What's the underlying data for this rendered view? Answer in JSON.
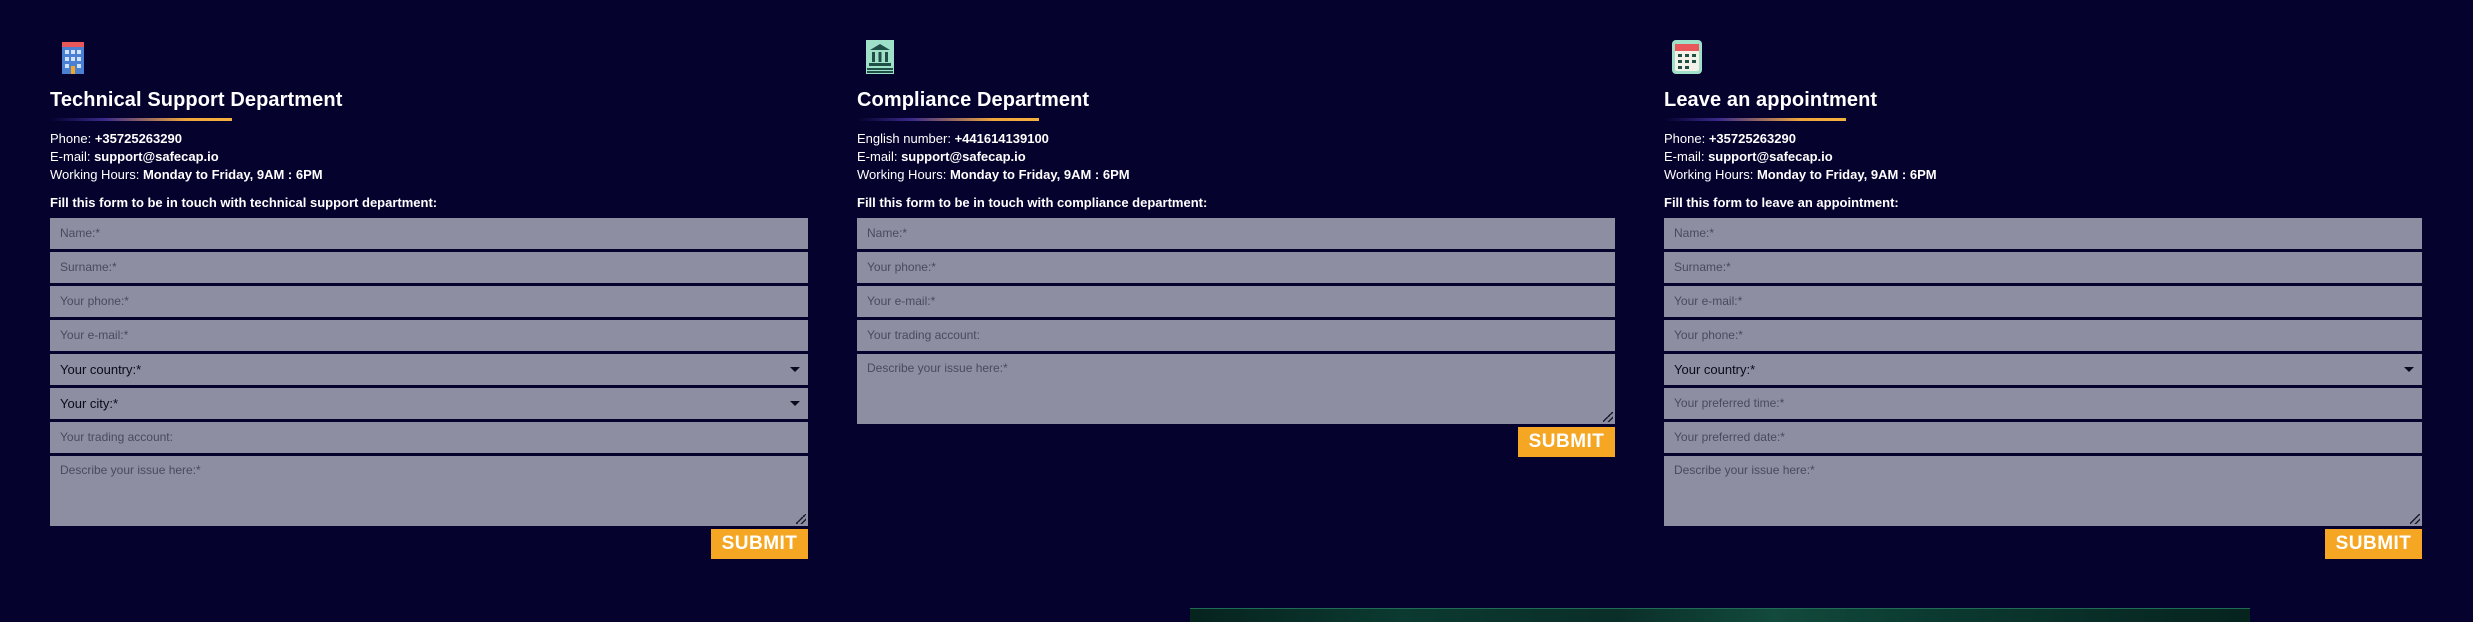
{
  "departments": [
    {
      "icon": "office-building-icon",
      "title": "Technical Support Department",
      "info": [
        {
          "label": "Phone: ",
          "value": "+35725263290"
        },
        {
          "label": "E-mail: ",
          "value": "support@safecap.io"
        },
        {
          "label": "Working Hours: ",
          "value": "Monday to Friday, 9AM : 6PM"
        }
      ],
      "form_note": "Fill this form to be in touch with technical support department:",
      "fields": [
        {
          "type": "input",
          "placeholder": "Name:*"
        },
        {
          "type": "input",
          "placeholder": "Surname:*"
        },
        {
          "type": "input",
          "placeholder": "Your phone:*"
        },
        {
          "type": "input",
          "placeholder": "Your e-mail:*"
        },
        {
          "type": "select",
          "value": "Your country:*"
        },
        {
          "type": "select",
          "value": "Your city:*"
        },
        {
          "type": "input",
          "placeholder": "Your trading account:"
        },
        {
          "type": "textarea",
          "placeholder": "Describe your issue here:*"
        }
      ],
      "submit_label": "SUBMIT"
    },
    {
      "icon": "bank-building-icon",
      "title": "Compliance Department",
      "info": [
        {
          "label": "English number: ",
          "value": "+441614139100"
        },
        {
          "label": "E-mail: ",
          "value": "support@safecap.io"
        },
        {
          "label": "Working Hours: ",
          "value": "Monday to Friday, 9AM : 6PM"
        }
      ],
      "form_note": "Fill this form to be in touch with compliance department:",
      "fields": [
        {
          "type": "input",
          "placeholder": "Name:*"
        },
        {
          "type": "input",
          "placeholder": "Your phone:*"
        },
        {
          "type": "input",
          "placeholder": "Your e-mail:*"
        },
        {
          "type": "input",
          "placeholder": "Your trading account:"
        },
        {
          "type": "textarea",
          "placeholder": "Describe your issue here:*"
        }
      ],
      "submit_label": "SUBMIT"
    },
    {
      "icon": "calendar-icon",
      "title": "Leave an appointment",
      "info": [
        {
          "label": "Phone: ",
          "value": "+35725263290"
        },
        {
          "label": "E-mail: ",
          "value": "support@safecap.io"
        },
        {
          "label": "Working Hours: ",
          "value": "Monday to Friday, 9AM : 6PM"
        }
      ],
      "form_note": "Fill this form to leave an appointment:",
      "fields": [
        {
          "type": "input",
          "placeholder": "Name:*"
        },
        {
          "type": "input",
          "placeholder": "Surname:*"
        },
        {
          "type": "input",
          "placeholder": "Your e-mail:*"
        },
        {
          "type": "input",
          "placeholder": "Your phone:*"
        },
        {
          "type": "select",
          "value": "Your country:*"
        },
        {
          "type": "input",
          "placeholder": "Your preferred time:*"
        },
        {
          "type": "input",
          "placeholder": "Your preferred date:*"
        },
        {
          "type": "textarea",
          "placeholder": "Describe your issue here:*"
        }
      ],
      "submit_label": "SUBMIT"
    }
  ],
  "colors": {
    "background": "#05022e",
    "field": "#8e8ea2",
    "accent": "#f5a623"
  }
}
